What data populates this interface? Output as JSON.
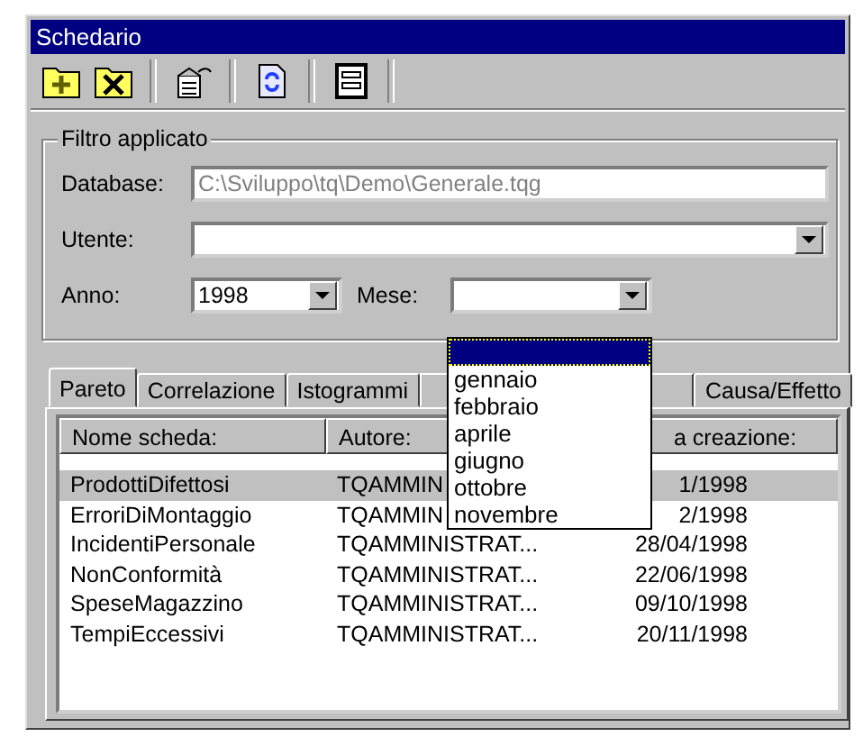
{
  "window": {
    "title": "Schedario"
  },
  "filter": {
    "title": "Filtro applicato",
    "database": {
      "label": "Database:",
      "value": "C:\\Sviluppo\\tq\\Demo\\Generale.tqg",
      "disabled": true
    },
    "user": {
      "label": "Utente:"
    },
    "year": {
      "label": "Anno:",
      "value": "1998"
    },
    "month": {
      "label": "Mese:",
      "open": true,
      "options": [
        {
          "selected": true
        },
        {
          "label": "gennaio",
          "selected": false
        },
        {
          "label": "febbraio",
          "selected": false
        },
        {
          "label": "aprile",
          "selected": false
        },
        {
          "label": "giugno",
          "selected": false
        },
        {
          "label": "ottobre",
          "selected": false
        },
        {
          "label": "novembre",
          "selected": false
        }
      ]
    }
  },
  "tabs": [
    {
      "label": "Pareto",
      "selected": true
    },
    {
      "label": "Correlazione",
      "selected": false
    },
    {
      "label": "Istogrammi",
      "selected": false
    },
    {
      "label": "Causa/Effetto",
      "selected": false
    }
  ],
  "list": {
    "columns": [
      "Nome scheda:",
      "Autore:",
      "a creazione:"
    ],
    "rows": [
      {
        "cells": [
          "ProdottiDifettosi",
          "TQAMMIN",
          "1/1998"
        ],
        "selected": true
      },
      {
        "cells": [
          "ErroriDiMontaggio",
          "TQAMMIN",
          "2/1998"
        ],
        "selected": false
      },
      {
        "cells": [
          "IncidentiPersonale",
          "TQAMMINISTRAT...",
          "28/04/1998"
        ],
        "selected": false
      },
      {
        "cells": [
          "NonConformità",
          "TQAMMINISTRAT...",
          "22/06/1998"
        ],
        "selected": false
      },
      {
        "cells": [
          "SpeseMagazzino",
          "TQAMMINISTRAT...",
          "09/10/1998"
        ],
        "selected": false
      },
      {
        "cells": [
          "TempiEccessivi",
          "TQAMMINISTRAT...",
          "20/11/1998"
        ],
        "selected": false
      }
    ]
  }
}
